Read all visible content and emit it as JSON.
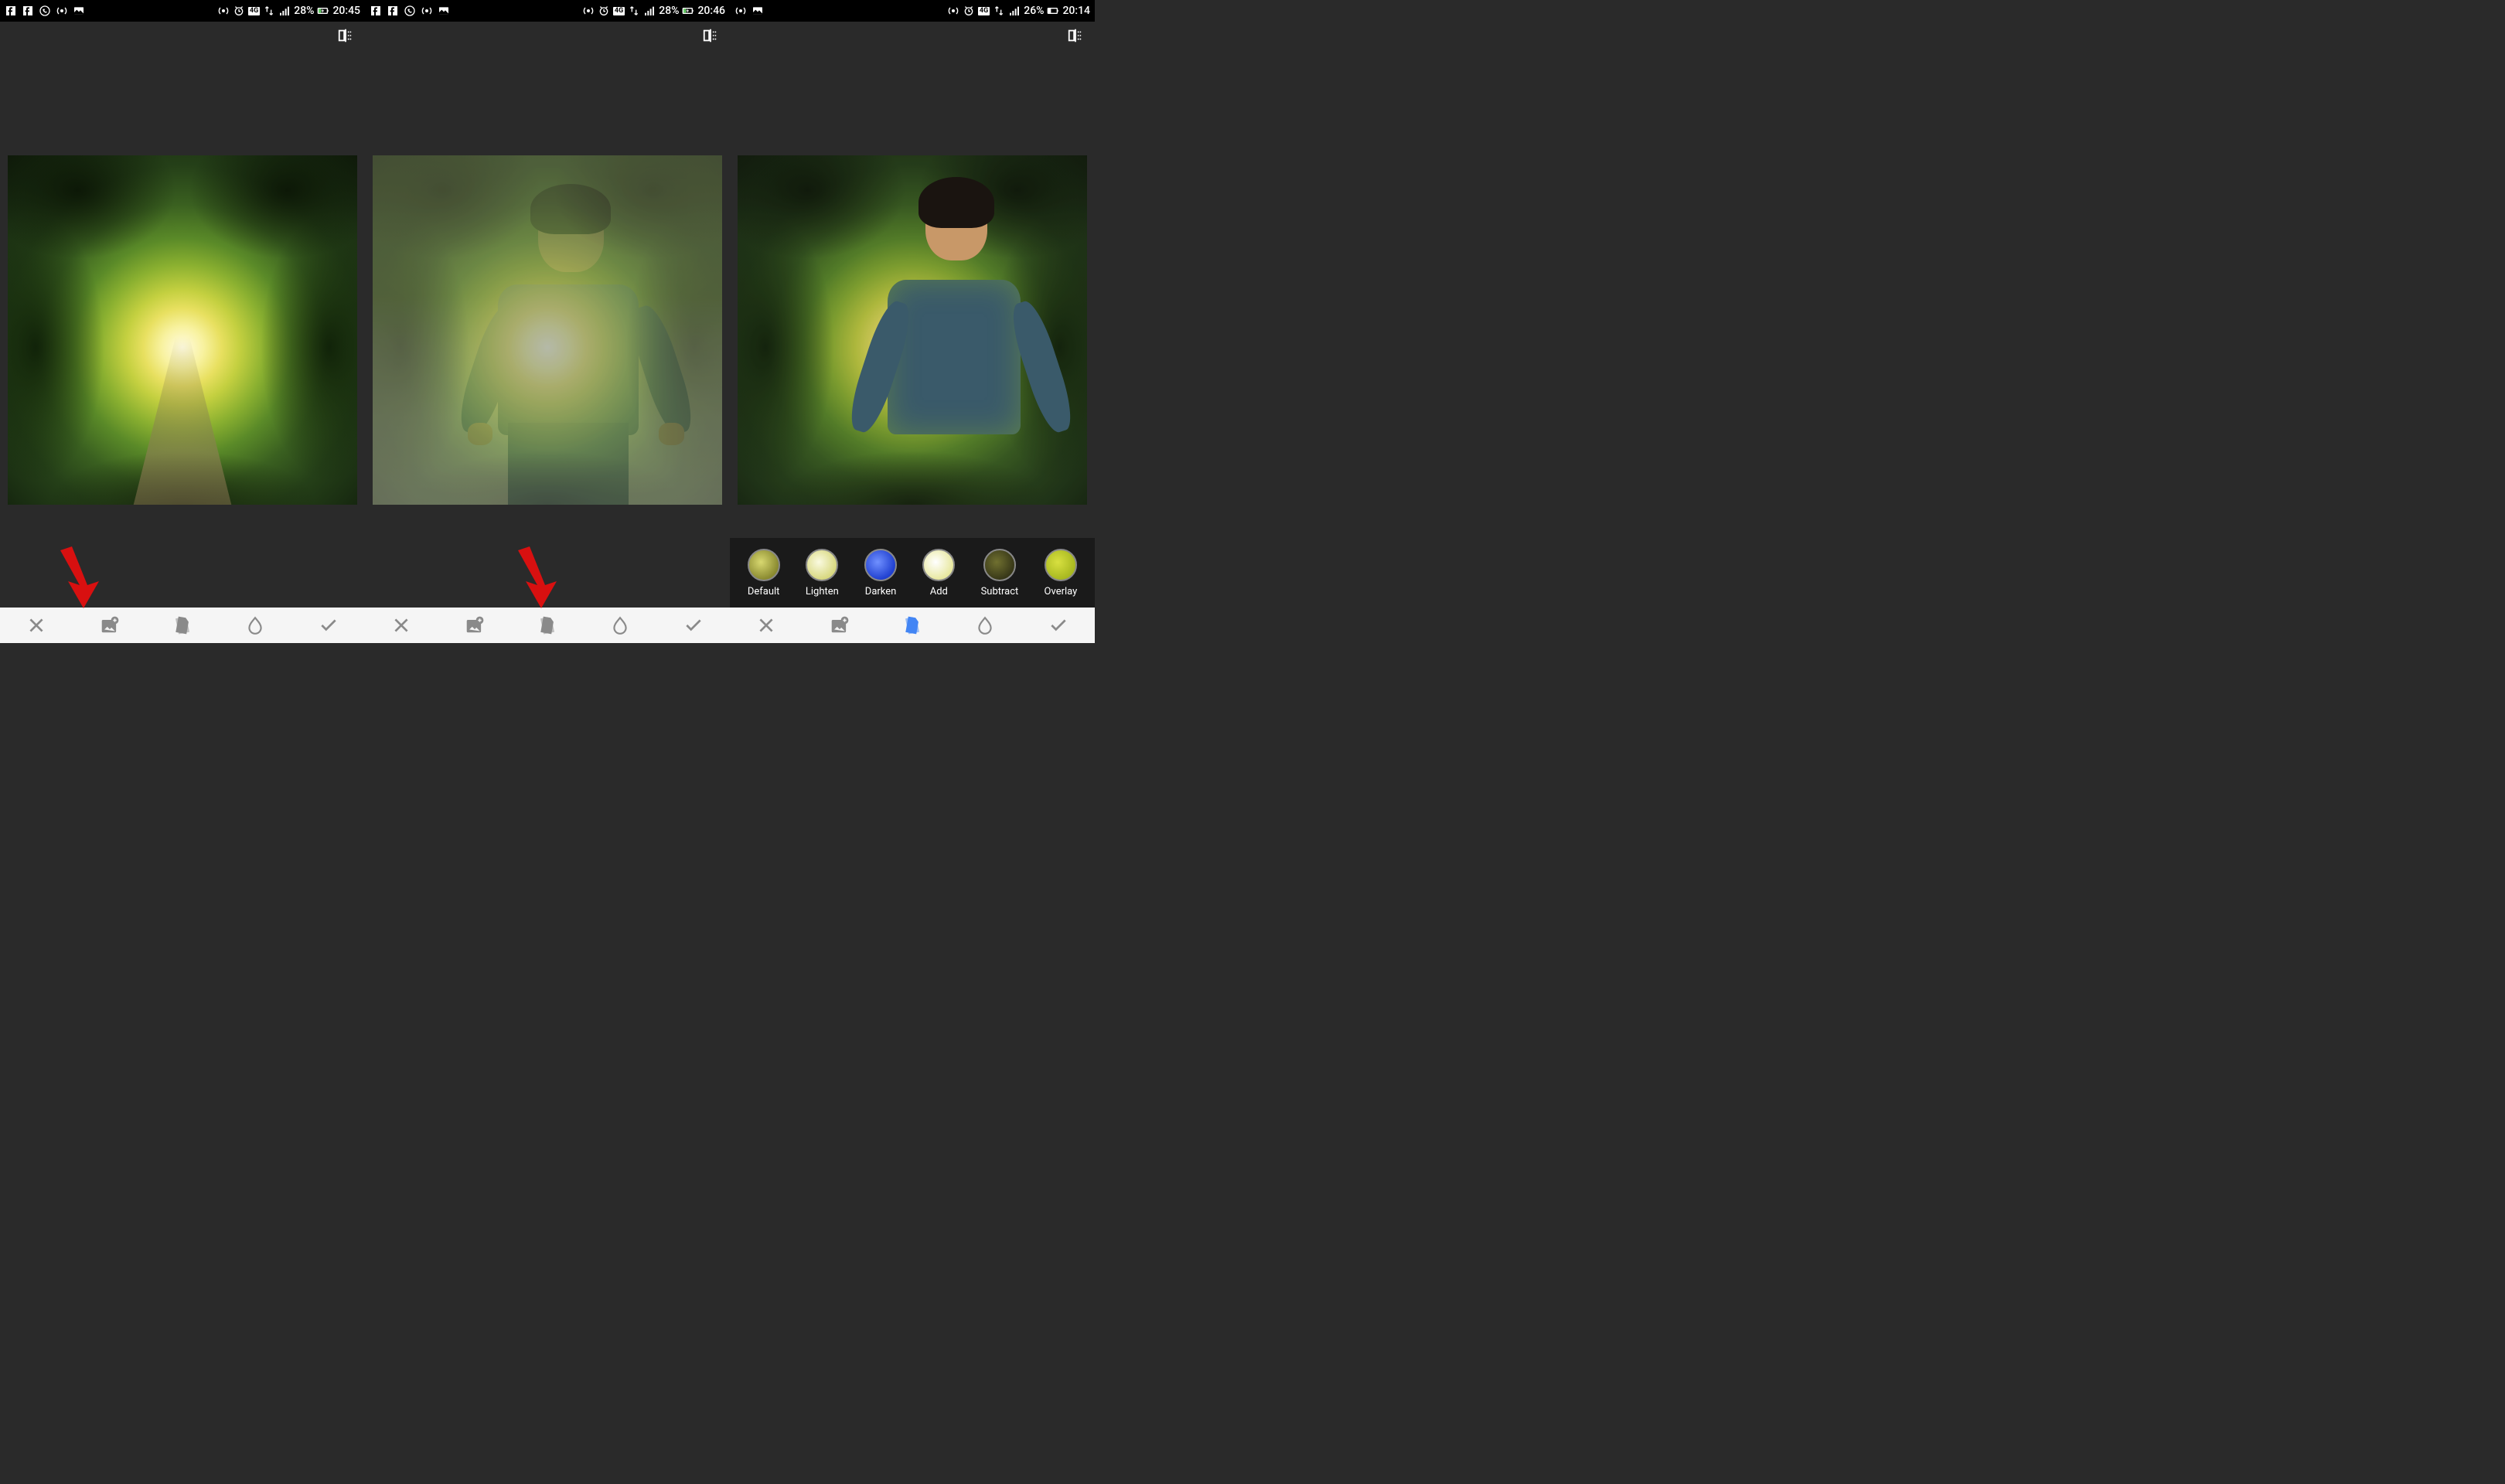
{
  "panels": [
    {
      "status": {
        "network": "4G",
        "battery_pct": "28%",
        "time": "20:45",
        "charging": true
      },
      "bottom_bar": {
        "active": null,
        "arrow_points_to": "add-image"
      }
    },
    {
      "status": {
        "network": "4G",
        "battery_pct": "28%",
        "time": "20:46",
        "charging": true
      },
      "bottom_bar": {
        "active": null,
        "arrow_points_to": "styles"
      }
    },
    {
      "status": {
        "network": "4G",
        "battery_pct": "26%",
        "time": "20:14",
        "charging": false
      },
      "bottom_bar": {
        "active": "styles"
      },
      "blend_modes": {
        "active": "Add",
        "items": [
          {
            "label": "Default"
          },
          {
            "label": "Lighten"
          },
          {
            "label": "Darken"
          },
          {
            "label": "Add"
          },
          {
            "label": "Subtract"
          },
          {
            "label": "Overlay"
          }
        ]
      }
    }
  ]
}
